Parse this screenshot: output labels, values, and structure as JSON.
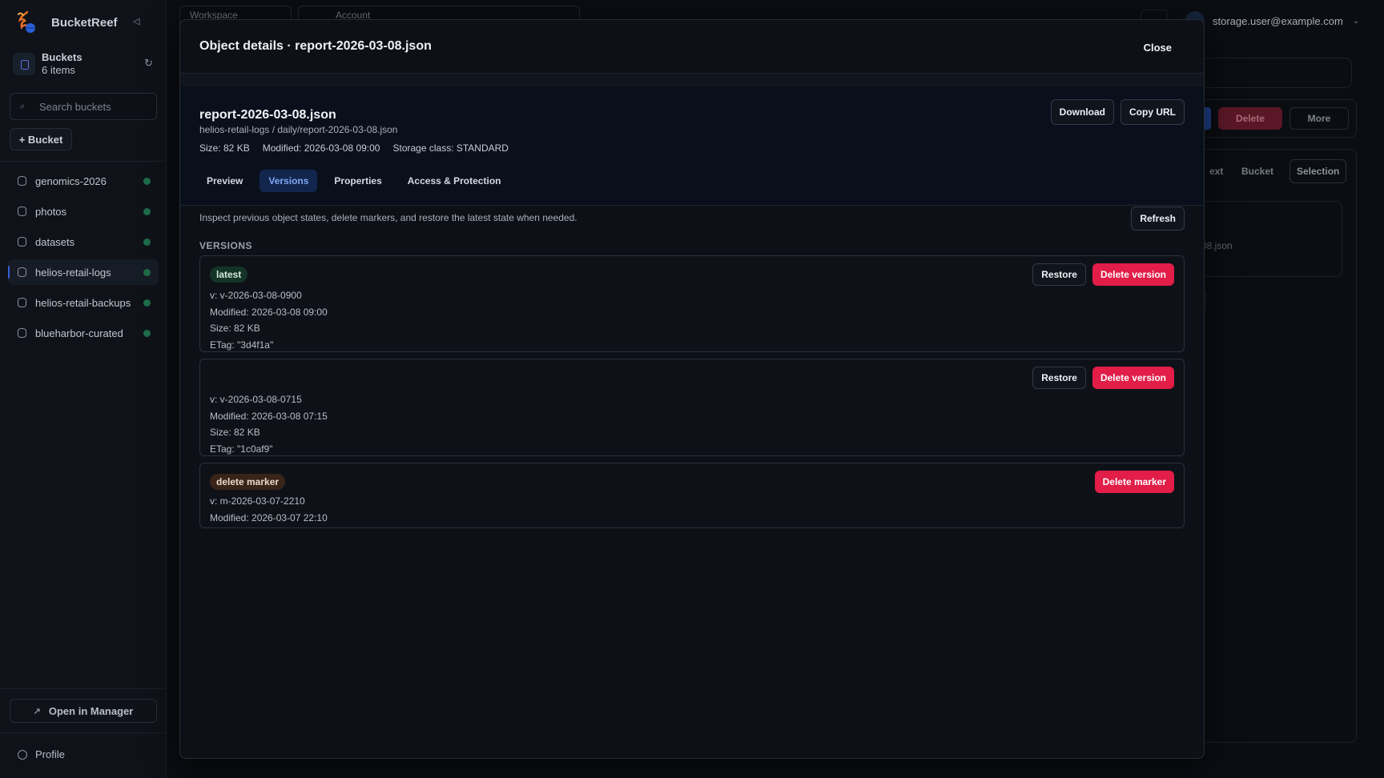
{
  "app": {
    "name": "BucketReef"
  },
  "sidebar": {
    "buckets_title": "Buckets",
    "buckets_count": "6 items",
    "search_placeholder": "Search buckets",
    "add_bucket": "+ Bucket",
    "items": [
      {
        "label": "genomics-2026",
        "active": false
      },
      {
        "label": "photos",
        "active": false
      },
      {
        "label": "datasets",
        "active": false
      },
      {
        "label": "helios-retail-logs",
        "active": true
      },
      {
        "label": "helios-retail-backups",
        "active": false
      },
      {
        "label": "blueharbor-curated",
        "active": false
      }
    ],
    "open_manager": "Open in Manager",
    "profile": "Profile"
  },
  "topbar": {
    "workspace": "Workspace",
    "account": "Account",
    "user_email": "storage.user@example.com"
  },
  "background": {
    "delete_label": "Delete",
    "more_label": "More",
    "tab_text": "ext",
    "tab_bucket": "Bucket",
    "tab_selection": "Selection",
    "json_fragment": "08.json"
  },
  "modal": {
    "title": "Object details · report-2026-03-08.json",
    "close": "Close",
    "object": {
      "name": "report-2026-03-08.json",
      "path": "helios-retail-logs / daily/report-2026-03-08.json",
      "size": "Size: 82 KB",
      "modified": "Modified: 2026-03-08 09:00",
      "storage_class": "Storage class: STANDARD",
      "download": "Download",
      "copy_url": "Copy URL"
    },
    "tabs": [
      {
        "label": "Preview",
        "active": false
      },
      {
        "label": "Versions",
        "active": true
      },
      {
        "label": "Properties",
        "active": false
      },
      {
        "label": "Access & Protection",
        "active": false
      }
    ],
    "intro": "Inspect previous object states, delete markers, and restore the latest state when needed.",
    "refresh": "Refresh",
    "versions_heading": "VERSIONS",
    "versions": [
      {
        "tag": "latest",
        "version": "v: v-2026-03-08-0900",
        "modified": "Modified: 2026-03-08 09:00",
        "size": "Size: 82 KB",
        "etag": "ETag: \"3d4f1a\"",
        "restore": "Restore",
        "delete": "Delete version"
      },
      {
        "tag": "",
        "version": "v: v-2026-03-08-0715",
        "modified": "Modified: 2026-03-08 07:15",
        "size": "Size: 82 KB",
        "etag": "ETag: \"1c0af9\"",
        "restore": "Restore",
        "delete": "Delete version"
      },
      {
        "tag": "delete marker",
        "version": "v: m-2026-03-07-2210",
        "modified": "Modified: 2026-03-07 22:10",
        "delete": "Delete marker"
      }
    ]
  },
  "colors": {
    "accent": "#3b5bdb",
    "danger": "#e11d48",
    "status_dot": "#1f6b4a"
  }
}
